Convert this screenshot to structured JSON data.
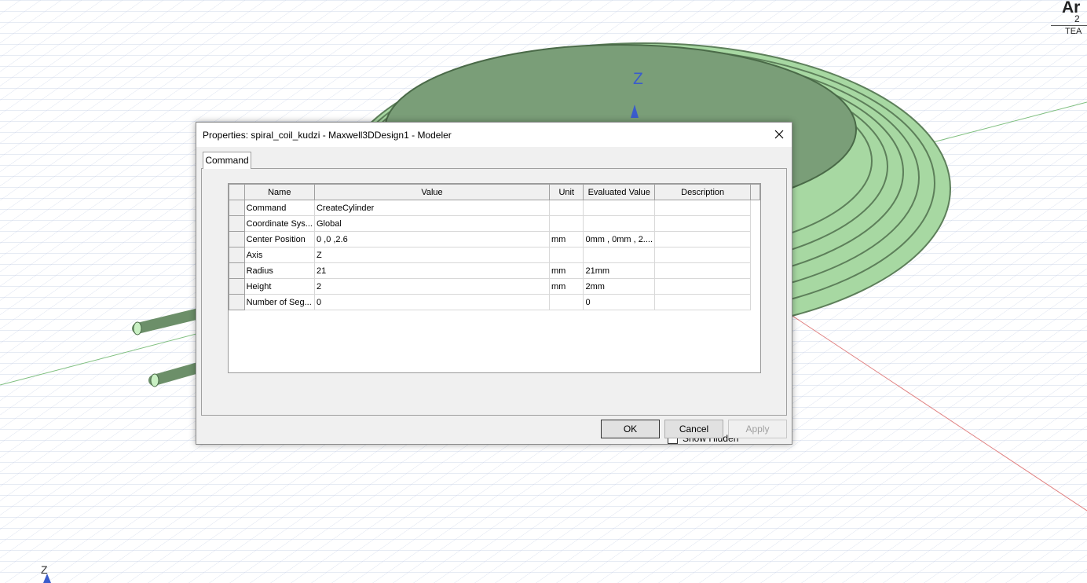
{
  "app": {
    "logo_text": "Ar",
    "logo_line2": "2",
    "logo_line3": "TEA"
  },
  "viewport": {
    "axis_label_main": "Z",
    "axis_label_corner": "Z",
    "coil_color": "#7a9e78",
    "grid_color": "#c9d3e8",
    "axis_color": "#3a5ccc"
  },
  "dialog": {
    "title": "Properties: spiral_coil_kudzi - Maxwell3DDesign1 - Modeler",
    "tab": "Command",
    "columns": {
      "name": "Name",
      "value": "Value",
      "unit": "Unit",
      "evaluated": "Evaluated Value",
      "description": "Description"
    },
    "rows": [
      {
        "name": "Command",
        "value": "CreateCylinder",
        "unit": "",
        "evaluated": "",
        "description": ""
      },
      {
        "name": "Coordinate Sys...",
        "value": "Global",
        "unit": "",
        "evaluated": "",
        "description": ""
      },
      {
        "name": "Center Position",
        "value": "0 ,0 ,2.6",
        "unit": "mm",
        "evaluated": "0mm , 0mm , 2....",
        "description": ""
      },
      {
        "name": "Axis",
        "value": "Z",
        "unit": "",
        "evaluated": "",
        "description": ""
      },
      {
        "name": "Radius",
        "value": "21",
        "unit": "mm",
        "evaluated": "21mm",
        "description": ""
      },
      {
        "name": "Height",
        "value": "2",
        "unit": "mm",
        "evaluated": "2mm",
        "description": ""
      },
      {
        "name": "Number of Seg...",
        "value": "0",
        "unit": "",
        "evaluated": "0",
        "description": ""
      }
    ],
    "show_hidden_label": "Show Hidden",
    "show_hidden_checked": false,
    "buttons": {
      "ok": "OK",
      "cancel": "Cancel",
      "apply": "Apply"
    }
  }
}
